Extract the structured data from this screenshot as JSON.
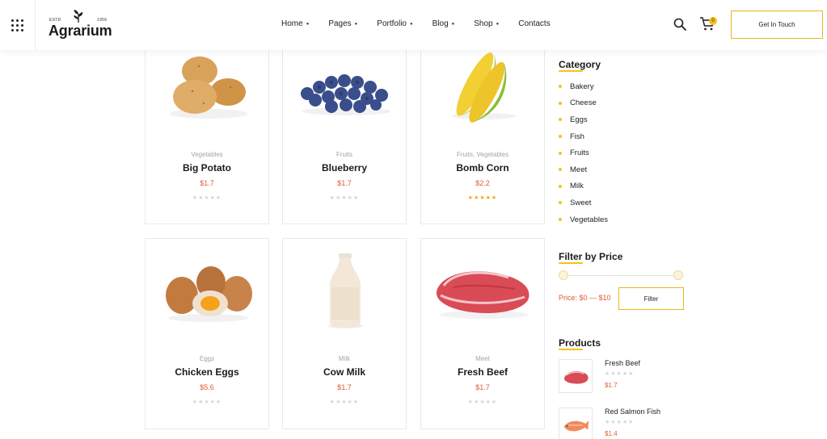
{
  "header": {
    "logo": {
      "estd": "ESTD",
      "year": "1956",
      "name": "Agrarium"
    },
    "nav": [
      {
        "label": "Home",
        "has_dropdown": true
      },
      {
        "label": "Pages",
        "has_dropdown": true
      },
      {
        "label": "Portfolio",
        "has_dropdown": true
      },
      {
        "label": "Blog",
        "has_dropdown": true
      },
      {
        "label": "Shop",
        "has_dropdown": true
      },
      {
        "label": "Contacts",
        "has_dropdown": false
      }
    ],
    "cart_count": "0",
    "cta_label": "Get In Touch",
    "icons": [
      "grid-menu-icon",
      "search-icon",
      "cart-icon"
    ]
  },
  "products": [
    {
      "category": "Vegetables",
      "name": "Big Potato",
      "price": "$1.7",
      "rating": 0
    },
    {
      "category": "Fruits",
      "name": "Blueberry",
      "price": "$1.7",
      "rating": 0
    },
    {
      "category": "Fruits, Vegetables",
      "name": "Bomb Corn",
      "price": "$2.2",
      "rating": 5
    },
    {
      "category": "Eggs",
      "name": "Chicken Eggs",
      "price": "$5.6",
      "rating": 0
    },
    {
      "category": "Milk",
      "name": "Cow Milk",
      "price": "$1.7",
      "rating": 0
    },
    {
      "category": "Meet",
      "name": "Fresh Beef",
      "price": "$1.7",
      "rating": 0
    }
  ],
  "sidebar": {
    "category_title": "Category",
    "categories": [
      "Bakery",
      "Cheese",
      "Eggs",
      "Fish",
      "Fruits",
      "Meet",
      "Milk",
      "Sweet",
      "Vegetables"
    ],
    "filter_title": "Filter by Price",
    "price_range_label": "Price: $0 — $10",
    "filter_button": "Filter",
    "products_title": "Products",
    "products": [
      {
        "name": "Fresh Beef",
        "price": "$1.7",
        "rating": 0
      },
      {
        "name": "Red Salmon Fish",
        "price": "$1.4",
        "rating": 0
      }
    ]
  },
  "colors": {
    "accent_yellow": "#f4c31b",
    "button_border": "#e8b61a",
    "price_orange": "#e05b31",
    "star_gold": "#f5a623",
    "star_empty": "#d6d6d6"
  }
}
